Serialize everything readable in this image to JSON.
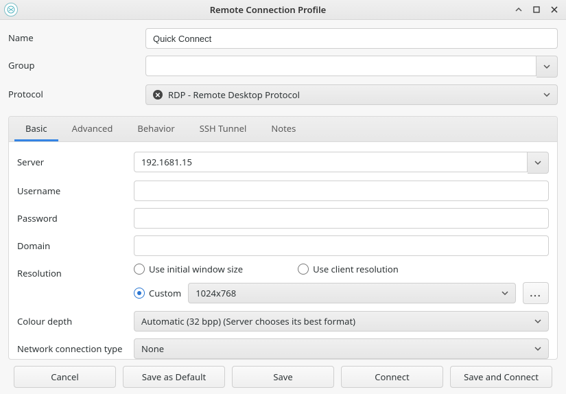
{
  "window": {
    "title": "Remote Connection Profile"
  },
  "top": {
    "name": {
      "label": "Name",
      "value": "Quick Connect"
    },
    "group": {
      "label": "Group",
      "value": ""
    },
    "protocol": {
      "label": "Protocol",
      "value": "RDP - Remote Desktop Protocol"
    }
  },
  "tabs": [
    "Basic",
    "Advanced",
    "Behavior",
    "SSH Tunnel",
    "Notes"
  ],
  "basic": {
    "server": {
      "label": "Server",
      "value": "192.1681.15"
    },
    "username": {
      "label": "Username",
      "value": ""
    },
    "password": {
      "label": "Password",
      "value": ""
    },
    "domain": {
      "label": "Domain",
      "value": ""
    },
    "resolution": {
      "label": "Resolution",
      "options": {
        "initial": "Use initial window size",
        "client": "Use client resolution",
        "custom": "Custom"
      },
      "selected": "custom",
      "custom_value": "1024x768"
    },
    "colour_depth": {
      "label": "Colour depth",
      "value": "Automatic (32 bpp) (Server chooses its best format)"
    },
    "net_type": {
      "label": "Network connection type",
      "value": "None"
    }
  },
  "footer": {
    "cancel": "Cancel",
    "save_default": "Save as Default",
    "save": "Save",
    "connect": "Connect",
    "save_connect": "Save and Connect"
  },
  "misc": {
    "ellipsis": "..."
  }
}
